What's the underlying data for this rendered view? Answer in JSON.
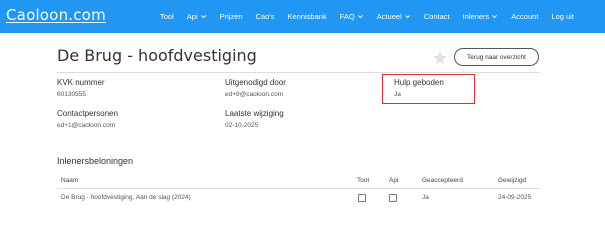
{
  "brand": {
    "logo_text": "Caoloon.com",
    "bar_color": "#2196f3"
  },
  "nav": {
    "items": [
      {
        "label": "Tool",
        "dropdown": false
      },
      {
        "label": "Api",
        "dropdown": true
      },
      {
        "label": "Prijzen",
        "dropdown": false
      },
      {
        "label": "Cao's",
        "dropdown": false
      },
      {
        "label": "Kennisbank",
        "dropdown": false
      },
      {
        "label": "FAQ",
        "dropdown": true
      },
      {
        "label": "Actueel",
        "dropdown": true
      },
      {
        "label": "Contact",
        "dropdown": false
      },
      {
        "label": "Inleners",
        "dropdown": true
      },
      {
        "label": "Account",
        "dropdown": false
      },
      {
        "label": "Log uit",
        "dropdown": false
      }
    ]
  },
  "page": {
    "title": "De Brug - hoofdvestiging",
    "favorite_icon": "star-icon",
    "back_button_label": "Terug naar overzicht"
  },
  "details": {
    "kvk_label": "KVK nummer",
    "kvk_value": "60130555",
    "invited_by_label": "Uitgenodigd door",
    "invited_by_value": "ed+9@caoloon.com",
    "help_label": "Hulp geboden",
    "help_value": "Ja",
    "contacts_label": "Contactpersonen",
    "contacts_value": "ed+1@caoloon.com",
    "last_change_label": "Laatste wijziging",
    "last_change_value": "02-10-2025",
    "highlight_color": "#d9303a"
  },
  "rewards": {
    "section_title": "Inlenersbeloningen",
    "columns": {
      "name": "Naam",
      "tool": "Tool",
      "api": "Api",
      "accepted": "Geaccepteerd",
      "changed": "Gewijzigd"
    },
    "rows": [
      {
        "name": "De Brug - hoofdvestiging, Aan de slag (2024)",
        "tool": false,
        "api": false,
        "accepted": "Ja",
        "changed": "24-09-2025"
      }
    ]
  }
}
